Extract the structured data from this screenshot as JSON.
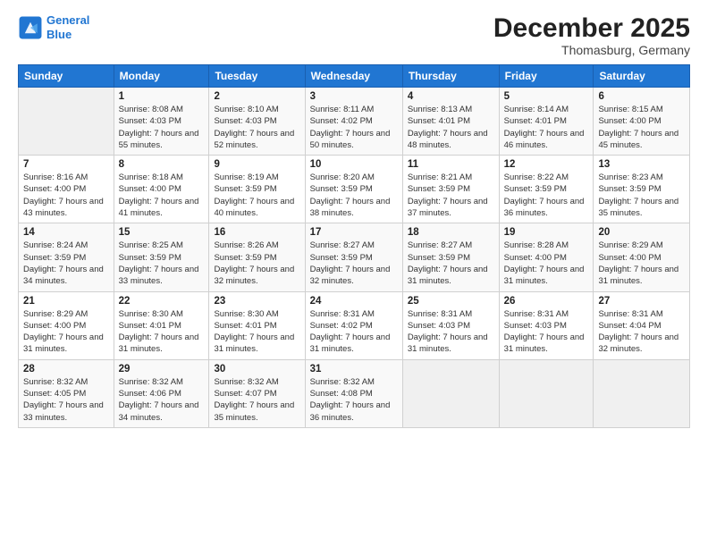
{
  "logo": {
    "line1": "General",
    "line2": "Blue"
  },
  "title": "December 2025",
  "location": "Thomasburg, Germany",
  "days_of_week": [
    "Sunday",
    "Monday",
    "Tuesday",
    "Wednesday",
    "Thursday",
    "Friday",
    "Saturday"
  ],
  "weeks": [
    [
      {
        "day": "",
        "sunrise": "",
        "sunset": "",
        "daylight": ""
      },
      {
        "day": "1",
        "sunrise": "Sunrise: 8:08 AM",
        "sunset": "Sunset: 4:03 PM",
        "daylight": "Daylight: 7 hours and 55 minutes."
      },
      {
        "day": "2",
        "sunrise": "Sunrise: 8:10 AM",
        "sunset": "Sunset: 4:03 PM",
        "daylight": "Daylight: 7 hours and 52 minutes."
      },
      {
        "day": "3",
        "sunrise": "Sunrise: 8:11 AM",
        "sunset": "Sunset: 4:02 PM",
        "daylight": "Daylight: 7 hours and 50 minutes."
      },
      {
        "day": "4",
        "sunrise": "Sunrise: 8:13 AM",
        "sunset": "Sunset: 4:01 PM",
        "daylight": "Daylight: 7 hours and 48 minutes."
      },
      {
        "day": "5",
        "sunrise": "Sunrise: 8:14 AM",
        "sunset": "Sunset: 4:01 PM",
        "daylight": "Daylight: 7 hours and 46 minutes."
      },
      {
        "day": "6",
        "sunrise": "Sunrise: 8:15 AM",
        "sunset": "Sunset: 4:00 PM",
        "daylight": "Daylight: 7 hours and 45 minutes."
      }
    ],
    [
      {
        "day": "7",
        "sunrise": "Sunrise: 8:16 AM",
        "sunset": "Sunset: 4:00 PM",
        "daylight": "Daylight: 7 hours and 43 minutes."
      },
      {
        "day": "8",
        "sunrise": "Sunrise: 8:18 AM",
        "sunset": "Sunset: 4:00 PM",
        "daylight": "Daylight: 7 hours and 41 minutes."
      },
      {
        "day": "9",
        "sunrise": "Sunrise: 8:19 AM",
        "sunset": "Sunset: 3:59 PM",
        "daylight": "Daylight: 7 hours and 40 minutes."
      },
      {
        "day": "10",
        "sunrise": "Sunrise: 8:20 AM",
        "sunset": "Sunset: 3:59 PM",
        "daylight": "Daylight: 7 hours and 38 minutes."
      },
      {
        "day": "11",
        "sunrise": "Sunrise: 8:21 AM",
        "sunset": "Sunset: 3:59 PM",
        "daylight": "Daylight: 7 hours and 37 minutes."
      },
      {
        "day": "12",
        "sunrise": "Sunrise: 8:22 AM",
        "sunset": "Sunset: 3:59 PM",
        "daylight": "Daylight: 7 hours and 36 minutes."
      },
      {
        "day": "13",
        "sunrise": "Sunrise: 8:23 AM",
        "sunset": "Sunset: 3:59 PM",
        "daylight": "Daylight: 7 hours and 35 minutes."
      }
    ],
    [
      {
        "day": "14",
        "sunrise": "Sunrise: 8:24 AM",
        "sunset": "Sunset: 3:59 PM",
        "daylight": "Daylight: 7 hours and 34 minutes."
      },
      {
        "day": "15",
        "sunrise": "Sunrise: 8:25 AM",
        "sunset": "Sunset: 3:59 PM",
        "daylight": "Daylight: 7 hours and 33 minutes."
      },
      {
        "day": "16",
        "sunrise": "Sunrise: 8:26 AM",
        "sunset": "Sunset: 3:59 PM",
        "daylight": "Daylight: 7 hours and 32 minutes."
      },
      {
        "day": "17",
        "sunrise": "Sunrise: 8:27 AM",
        "sunset": "Sunset: 3:59 PM",
        "daylight": "Daylight: 7 hours and 32 minutes."
      },
      {
        "day": "18",
        "sunrise": "Sunrise: 8:27 AM",
        "sunset": "Sunset: 3:59 PM",
        "daylight": "Daylight: 7 hours and 31 minutes."
      },
      {
        "day": "19",
        "sunrise": "Sunrise: 8:28 AM",
        "sunset": "Sunset: 4:00 PM",
        "daylight": "Daylight: 7 hours and 31 minutes."
      },
      {
        "day": "20",
        "sunrise": "Sunrise: 8:29 AM",
        "sunset": "Sunset: 4:00 PM",
        "daylight": "Daylight: 7 hours and 31 minutes."
      }
    ],
    [
      {
        "day": "21",
        "sunrise": "Sunrise: 8:29 AM",
        "sunset": "Sunset: 4:00 PM",
        "daylight": "Daylight: 7 hours and 31 minutes."
      },
      {
        "day": "22",
        "sunrise": "Sunrise: 8:30 AM",
        "sunset": "Sunset: 4:01 PM",
        "daylight": "Daylight: 7 hours and 31 minutes."
      },
      {
        "day": "23",
        "sunrise": "Sunrise: 8:30 AM",
        "sunset": "Sunset: 4:01 PM",
        "daylight": "Daylight: 7 hours and 31 minutes."
      },
      {
        "day": "24",
        "sunrise": "Sunrise: 8:31 AM",
        "sunset": "Sunset: 4:02 PM",
        "daylight": "Daylight: 7 hours and 31 minutes."
      },
      {
        "day": "25",
        "sunrise": "Sunrise: 8:31 AM",
        "sunset": "Sunset: 4:03 PM",
        "daylight": "Daylight: 7 hours and 31 minutes."
      },
      {
        "day": "26",
        "sunrise": "Sunrise: 8:31 AM",
        "sunset": "Sunset: 4:03 PM",
        "daylight": "Daylight: 7 hours and 31 minutes."
      },
      {
        "day": "27",
        "sunrise": "Sunrise: 8:31 AM",
        "sunset": "Sunset: 4:04 PM",
        "daylight": "Daylight: 7 hours and 32 minutes."
      }
    ],
    [
      {
        "day": "28",
        "sunrise": "Sunrise: 8:32 AM",
        "sunset": "Sunset: 4:05 PM",
        "daylight": "Daylight: 7 hours and 33 minutes."
      },
      {
        "day": "29",
        "sunrise": "Sunrise: 8:32 AM",
        "sunset": "Sunset: 4:06 PM",
        "daylight": "Daylight: 7 hours and 34 minutes."
      },
      {
        "day": "30",
        "sunrise": "Sunrise: 8:32 AM",
        "sunset": "Sunset: 4:07 PM",
        "daylight": "Daylight: 7 hours and 35 minutes."
      },
      {
        "day": "31",
        "sunrise": "Sunrise: 8:32 AM",
        "sunset": "Sunset: 4:08 PM",
        "daylight": "Daylight: 7 hours and 36 minutes."
      },
      {
        "day": "",
        "sunrise": "",
        "sunset": "",
        "daylight": ""
      },
      {
        "day": "",
        "sunrise": "",
        "sunset": "",
        "daylight": ""
      },
      {
        "day": "",
        "sunrise": "",
        "sunset": "",
        "daylight": ""
      }
    ]
  ]
}
